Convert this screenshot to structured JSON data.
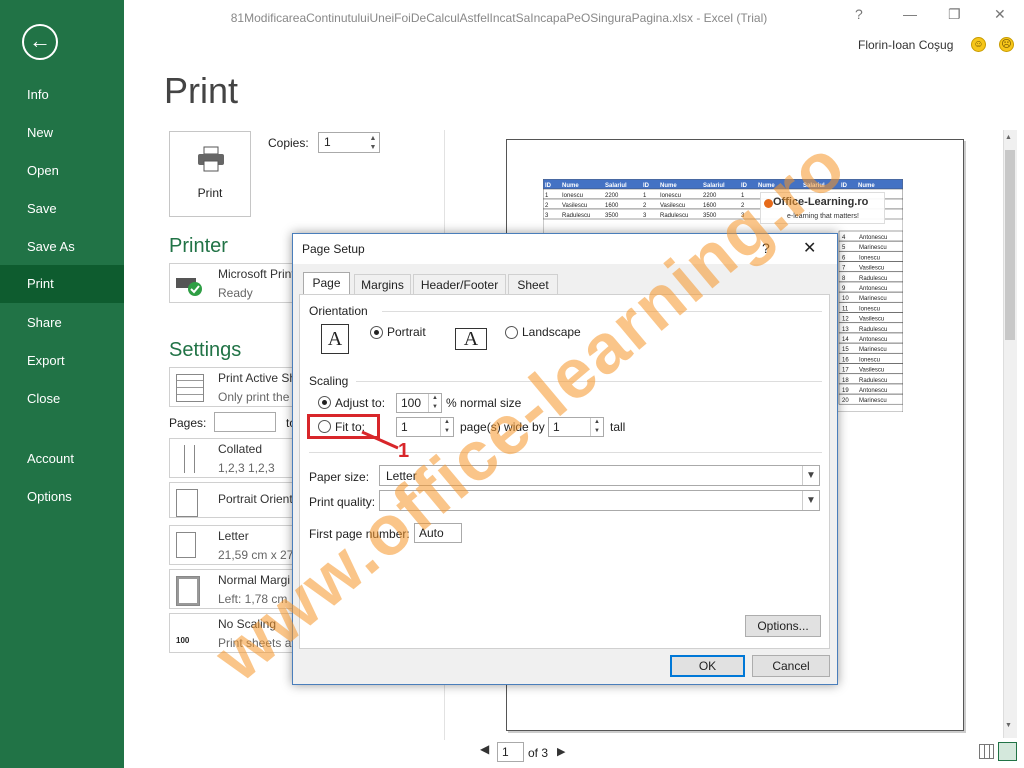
{
  "window": {
    "title": "81ModificareaContinutuluiUneiFoiDeCalculAstfelIncatSaIncapaPeOSinguraPagina.xlsx - Excel (Trial)",
    "help": "?",
    "minimize": "—",
    "restore": "❐",
    "close": "✕",
    "user": "Florin-Ioan Coşug",
    "smile": "☺",
    "frown": "☹"
  },
  "sidebar": {
    "back": "←",
    "items": [
      "Info",
      "New",
      "Open",
      "Save",
      "Save As",
      "Print",
      "Share",
      "Export",
      "Close",
      "Account",
      "Options"
    ],
    "selected": "Print"
  },
  "print": {
    "title": "Print",
    "print_button": "Print",
    "copies_label": "Copies:",
    "copies_value": "1",
    "printer_section": "Printer",
    "printer_name": "Microsoft Print",
    "printer_status": "Ready",
    "settings_section": "Settings",
    "active_sheets": "Print Active Sh",
    "active_sheets_sub": "Only print the",
    "pages_label": "Pages:",
    "pages_to": "to",
    "collated": "Collated",
    "collated_sub": "1,2,3    1,2,3",
    "orientation": "Portrait Orient",
    "paper": "Letter",
    "paper_sub": "21,59 cm x 27,",
    "margins": "Normal Margi",
    "margins_sub": "Left: 1,78 cm",
    "scaling": "No Scaling",
    "scaling_sub": "Print sheets at",
    "scaling_icon": "100"
  },
  "preview": {
    "page_current": "1",
    "page_total": "of 3",
    "headers": [
      "ID",
      "Nume",
      "Salariul",
      "ID",
      "Nume",
      "Salariul",
      "ID",
      "Nume",
      "Salariul",
      "ID",
      "Nume"
    ],
    "rows_top": [
      [
        "1",
        "Ionescu",
        "2200",
        "1",
        "Ionescu",
        "2200",
        "1"
      ],
      [
        "2",
        "Vasilescu",
        "1600",
        "2",
        "Vasilescu",
        "1600",
        "2"
      ],
      [
        "3",
        "Radulescu",
        "3500",
        "3",
        "Radulescu",
        "3500",
        "3"
      ]
    ],
    "right_col": [
      [
        "4",
        "Antonescu"
      ],
      [
        "5",
        "Marinescu"
      ],
      [
        "6",
        "Ionescu"
      ],
      [
        "7",
        "Vasilescu"
      ],
      [
        "8",
        "Radulescu"
      ],
      [
        "9",
        "Antonescu"
      ],
      [
        "10",
        "Marinescu"
      ],
      [
        "11",
        "Ionescu"
      ],
      [
        "12",
        "Vasilescu"
      ],
      [
        "13",
        "Radulescu"
      ],
      [
        "14",
        "Antonescu"
      ],
      [
        "15",
        "Marinescu"
      ],
      [
        "16",
        "Ionescu"
      ],
      [
        "17",
        "Vasilescu"
      ],
      [
        "18",
        "Radulescu"
      ],
      [
        "19",
        "Antonescu"
      ],
      [
        "20",
        "Marinescu"
      ]
    ],
    "logo_title": "Office-Learning.ro",
    "logo_sub": "e-learning that matters!"
  },
  "watermark": "www.office-learning.ro",
  "dialog": {
    "title": "Page Setup",
    "help": "?",
    "close": "✕",
    "tabs": [
      "Page",
      "Margins",
      "Header/Footer",
      "Sheet"
    ],
    "orientation_label": "Orientation",
    "portrait": "Portrait",
    "landscape": "Landscape",
    "orient_glyph": "A",
    "scaling_label": "Scaling",
    "adjust_to": "Adjust to:",
    "adjust_value": "100",
    "normal_size": "% normal size",
    "fit_to": "Fit to:",
    "fit_wide_value": "1",
    "pages_wide_by": "page(s) wide by",
    "fit_tall_value": "1",
    "tall": "tall",
    "paper_size_label": "Paper size:",
    "paper_size_value": "Letter",
    "print_quality_label": "Print quality:",
    "print_quality_value": "",
    "first_page_label": "First page number:",
    "first_page_value": "Auto",
    "options_button": "Options...",
    "ok_button": "OK",
    "cancel_button": "Cancel"
  },
  "annotation": {
    "number": "1"
  }
}
